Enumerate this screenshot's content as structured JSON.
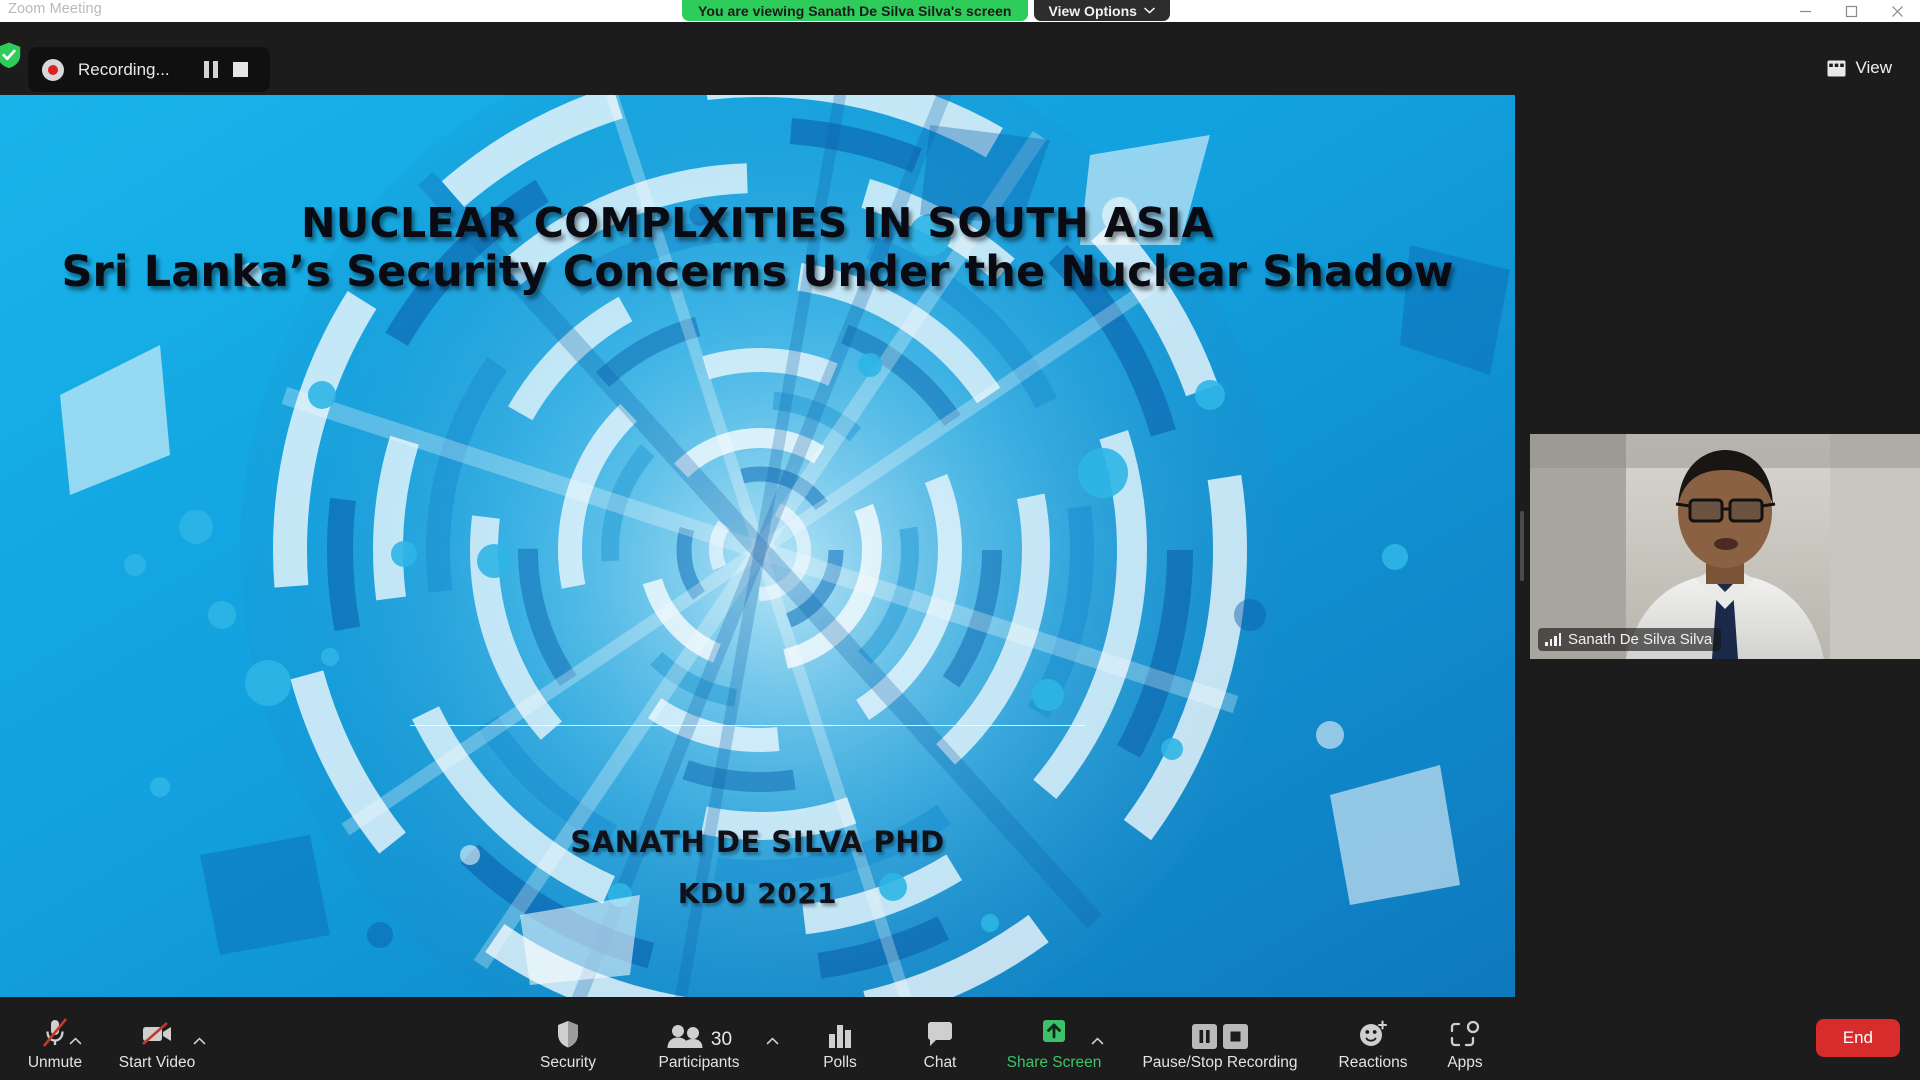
{
  "window": {
    "title": "Zoom Meeting",
    "controls": [
      {
        "name": "minimize",
        "glyph": "minimize-icon"
      },
      {
        "name": "maximize",
        "glyph": "maximize-icon"
      },
      {
        "name": "close",
        "glyph": "close-icon"
      }
    ]
  },
  "share_banner": {
    "message": "You are viewing Sanath De Silva Silva's screen",
    "view_options_label": "View Options",
    "chevron_icon": "chevron-down-icon",
    "pill_color": "#2ecc5a",
    "button_color": "#2d2d2d"
  },
  "topbar": {
    "encryption_icon": "shield-check-icon",
    "encryption_color": "#2ecc5a",
    "recording": {
      "status_label": "Recording...",
      "record_dot_icon": "record-dot-icon",
      "record_dot_color": "#e02020",
      "pause_icon": "pause-icon",
      "stop_icon": "stop-icon"
    },
    "view_button": {
      "label": "View",
      "icon": "grid-view-icon"
    }
  },
  "shared_screen": {
    "presenter": "Sanath De Silva Silva",
    "slide": {
      "title_line_1": "NUCLEAR COMPLXITIES IN SOUTH ASIA",
      "title_line_2": "Sri Lanka’s Security Concerns Under the Nuclear Shadow",
      "author": "SANATH DE SILVA PHD",
      "organization": "KDU 2021",
      "background_theme": "blue-tech-circles",
      "background_colors": [
        "#0a5ba8",
        "#17a2dd",
        "#6fc9e8",
        "#ffffff"
      ]
    }
  },
  "video_tile": {
    "participant_name": "Sanath De Silva Silva",
    "signal_icon": "signal-bars-icon"
  },
  "toolbar": {
    "items": [
      {
        "id": "unmute",
        "label": "Unmute",
        "icon": "microphone-muted-icon",
        "has_caret": true,
        "accent": "default"
      },
      {
        "id": "start-video",
        "label": "Start Video",
        "icon": "video-off-icon",
        "has_caret": true,
        "accent": "default"
      },
      {
        "id": "security",
        "label": "Security",
        "icon": "shield-icon",
        "has_caret": false,
        "accent": "default"
      },
      {
        "id": "participants",
        "label": "Participants",
        "icon": "participants-icon",
        "has_caret": true,
        "accent": "default",
        "count": "30"
      },
      {
        "id": "polls",
        "label": "Polls",
        "icon": "polls-bar-icon",
        "has_caret": false,
        "accent": "default"
      },
      {
        "id": "chat",
        "label": "Chat",
        "icon": "chat-bubble-icon",
        "has_caret": false,
        "accent": "default"
      },
      {
        "id": "share-screen",
        "label": "Share Screen",
        "icon": "share-screen-icon",
        "has_caret": true,
        "accent": "green"
      },
      {
        "id": "recording",
        "label": "Pause/Stop Recording",
        "icon": "pause-stop-icon",
        "has_caret": false,
        "accent": "default"
      },
      {
        "id": "reactions",
        "label": "Reactions",
        "icon": "reactions-smiley-icon",
        "has_caret": false,
        "accent": "default"
      },
      {
        "id": "apps",
        "label": "Apps",
        "icon": "apps-icon",
        "has_caret": false,
        "accent": "default"
      }
    ],
    "end_button": {
      "label": "End",
      "color": "#d82b2b"
    }
  }
}
